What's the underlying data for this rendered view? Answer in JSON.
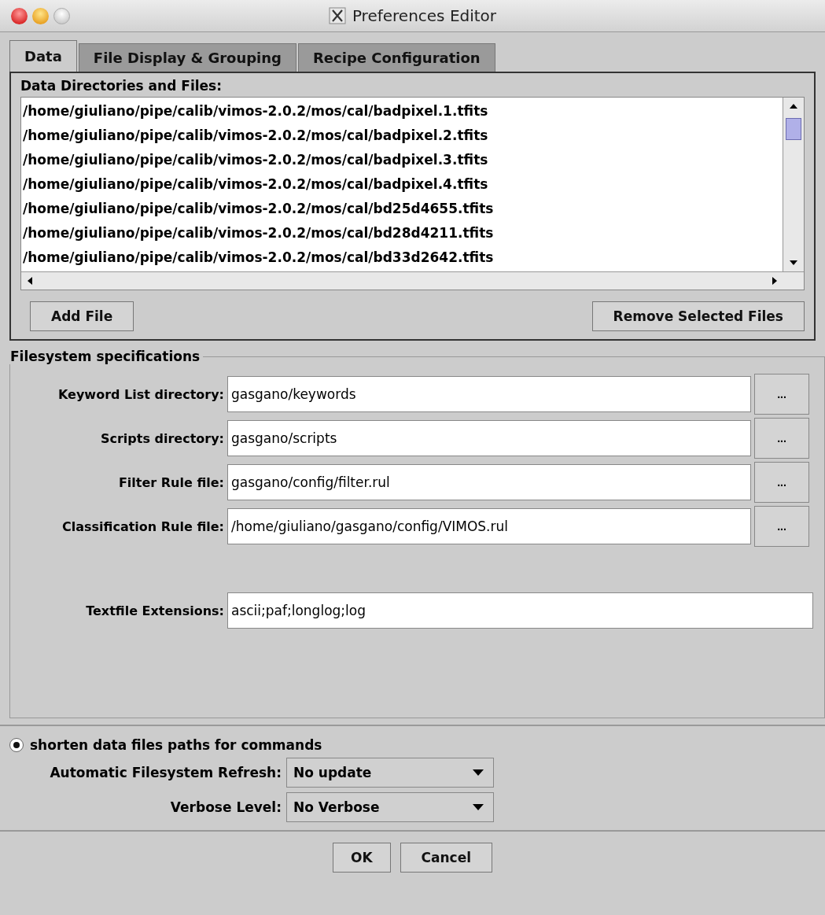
{
  "window": {
    "title": "Preferences Editor"
  },
  "tabs": [
    {
      "label": "Data",
      "selected": true
    },
    {
      "label": "File Display & Grouping",
      "selected": false
    },
    {
      "label": "Recipe Configuration",
      "selected": false
    }
  ],
  "data_files": {
    "label": "Data Directories and Files:",
    "items": [
      "/home/giuliano/pipe/calib/vimos-2.0.2/mos/cal/badpixel.1.tfits",
      "/home/giuliano/pipe/calib/vimos-2.0.2/mos/cal/badpixel.2.tfits",
      "/home/giuliano/pipe/calib/vimos-2.0.2/mos/cal/badpixel.3.tfits",
      "/home/giuliano/pipe/calib/vimos-2.0.2/mos/cal/badpixel.4.tfits",
      "/home/giuliano/pipe/calib/vimos-2.0.2/mos/cal/bd25d4655.tfits",
      "/home/giuliano/pipe/calib/vimos-2.0.2/mos/cal/bd28d4211.tfits",
      "/home/giuliano/pipe/calib/vimos-2.0.2/mos/cal/bd33d2642.tfits"
    ],
    "add_button": "Add File",
    "remove_button": "Remove Selected Files"
  },
  "filesystem": {
    "title": "Filesystem specifications",
    "fields": [
      {
        "label": "Keyword List directory:",
        "value": "gasgano/keywords",
        "browse": "..."
      },
      {
        "label": "Scripts directory:",
        "value": "gasgano/scripts",
        "browse": "..."
      },
      {
        "label": "Filter Rule file:",
        "value": "gasgano/config/filter.rul",
        "browse": "..."
      },
      {
        "label": "Classification Rule file:",
        "value": "/home/giuliano/gasgano/config/VIMOS.rul",
        "browse": "..."
      }
    ],
    "extensions": {
      "label": "Textfile Extensions:",
      "value": "ascii;paf;longlog;log"
    }
  },
  "options": {
    "shorten": {
      "label": "shorten data files paths for commands",
      "checked": true
    },
    "selects": [
      {
        "label": "Automatic Filesystem Refresh:",
        "value": "No update"
      },
      {
        "label": "Verbose Level:",
        "value": "No Verbose"
      }
    ]
  },
  "buttons": [
    "OK",
    "Cancel"
  ]
}
